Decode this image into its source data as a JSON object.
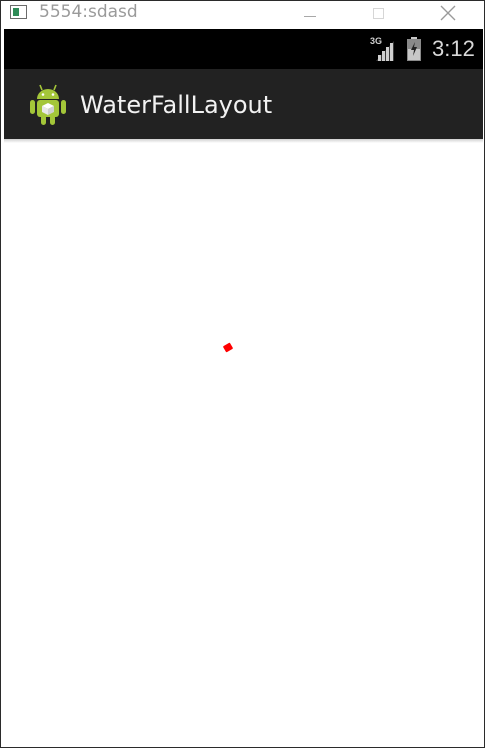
{
  "window": {
    "title": "5554:sdasd",
    "icon": "emulator-window-icon",
    "buttons": {
      "minimize": "minimize-icon",
      "maximize": "maximize-icon",
      "close": "close-icon"
    }
  },
  "status_bar": {
    "network": "3G",
    "time": "3:12"
  },
  "action_bar": {
    "title": "WaterFallLayout",
    "icon": "android-icon"
  },
  "colors": {
    "status_bar_bg": "#000000",
    "action_bar_bg": "#222222",
    "content_bg": "#ffffff",
    "android_green": "#a4c639",
    "marker_red": "#ff0000"
  }
}
